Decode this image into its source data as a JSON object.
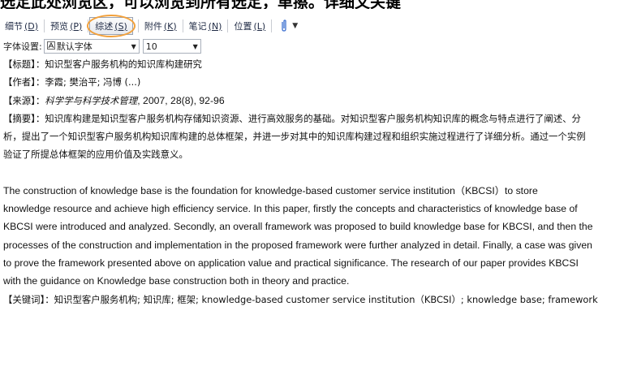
{
  "top_strip_text": "选定此处浏览区，可以浏览到所有选定，单擦。详细文关键",
  "toolbar": {
    "tabs": [
      {
        "label": "细节",
        "key": "(D)"
      },
      {
        "label": "预览",
        "key": "(P)"
      },
      {
        "label": "综述",
        "key": "(S)"
      },
      {
        "label": "附件",
        "key": "(K)"
      },
      {
        "label": "笔记",
        "key": "(N)"
      },
      {
        "label": "位置",
        "key": "(L)"
      }
    ],
    "active_tab": "综述",
    "dropdown_arrow": "▼"
  },
  "font_settings": {
    "label": "字体设置:",
    "font_value": "默认字体",
    "size_value": "10"
  },
  "record": {
    "title_label": "【标题】",
    "title_value": "：知识型客户服务机构的知识库构建研究",
    "author_label": "【作者】",
    "author_value": "：李霞; 樊治平; 冯博 (...)",
    "source_label": "【来源】",
    "source_sep": "：",
    "source_journal": "科学学与科学技术管理",
    "source_details": ", 2007, 28(8), 92-96",
    "abstract_label": "【摘要】",
    "abstract_zh_1": "：知识库构建是知识型客户服务机构存储知识资源、进行高效服务的基础。对知识型客户服务机构知识库的概念与特点进行了阐述、分",
    "abstract_zh_2": "析，提出了一个知识型客户服务机构知识库构建的总体框架，并进一步对其中的知识库构建过程和组织实施过程进行了详细分析。通过一个实例",
    "abstract_zh_3": "验证了所提总体框架的应用价值及实践意义。",
    "abstract_en_1": "The construction of knowledge base is the foundation for knowledge-based customer service institution（KBCSI）to store",
    "abstract_en_2": "knowledge resource and achieve high efficiency service. In this paper, firstly the concepts and characteristics of knowledge base of",
    "abstract_en_3": "KBCSI were introduced and analyzed. Secondly, an overall framework was proposed to build knowledge base for KBCSI, and then the",
    "abstract_en_4": "processes of the construction and implementation in the proposed framework were further analyzed in detail. Finally, a case was given",
    "abstract_en_5": "to prove the framework presented above on application value and practical significance. The research of our paper provides KBCSI",
    "abstract_en_6": "with the guidance on Knowledge base construction both in theory and practice.",
    "keywords_label": "【关键词】",
    "keywords_value": "：知识型客户服务机构; 知识库; 框架; knowledge-based customer service institution（KBCSI）; knowledge base; framework"
  }
}
